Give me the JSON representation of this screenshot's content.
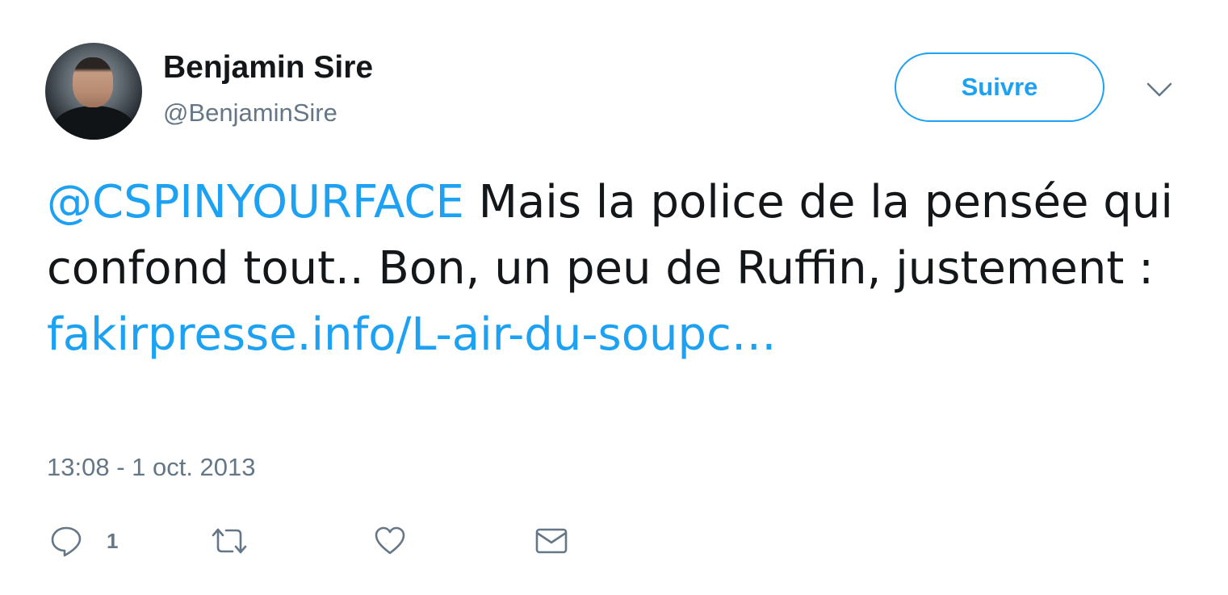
{
  "author": {
    "name": "Benjamin Sire",
    "handle": "@BenjaminSire"
  },
  "follow_button": {
    "label": "Suivre"
  },
  "menu": {
    "icon": "chevron-down-icon"
  },
  "tweet": {
    "mention": "@CSPINYOURFACE",
    "text_part1": " Mais la police de la pensée qui confond tout.. Bon, un peu de Ruffin, justement : ",
    "link": "fakirpresse.info/L-air-du-soupc…"
  },
  "timestamp": "13:08 - 1 oct. 2013",
  "actions": {
    "reply": {
      "icon": "reply-icon",
      "count": "1"
    },
    "retweet": {
      "icon": "retweet-icon"
    },
    "like": {
      "icon": "heart-icon"
    },
    "dm": {
      "icon": "envelope-icon"
    }
  },
  "colors": {
    "accent": "#1da1f2",
    "text": "#14171a",
    "secondary": "#657786"
  }
}
